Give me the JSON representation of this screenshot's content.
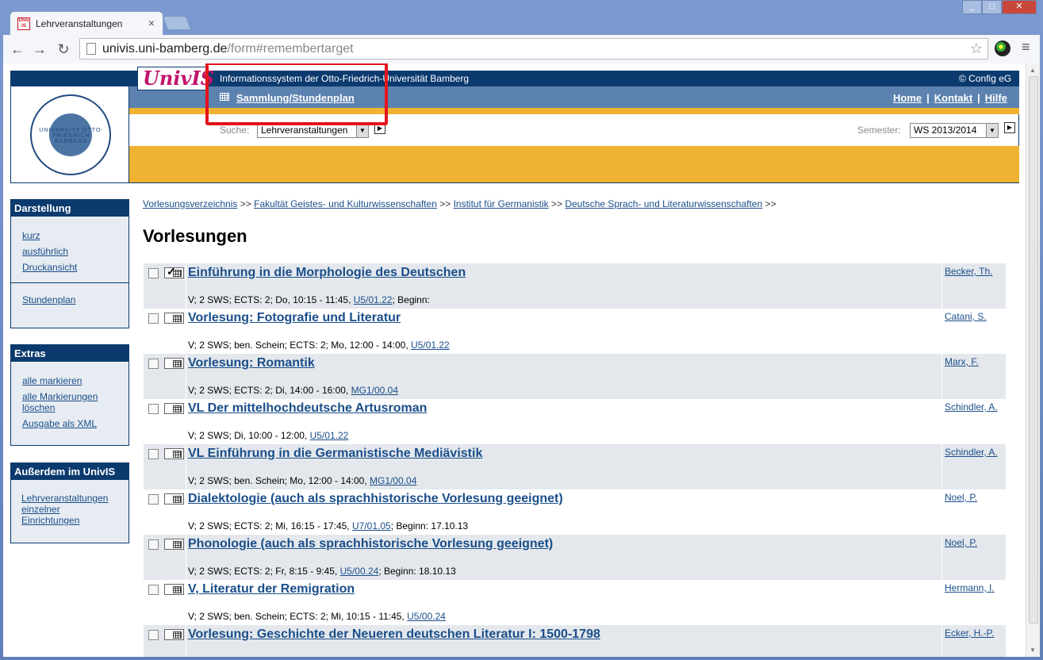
{
  "browser": {
    "tab_title": "Lehrveranstaltungen",
    "favicon_text": "Univ IS",
    "url_host": "univis.uni-bamberg.de",
    "url_rest": "/form#remembertarget"
  },
  "header": {
    "logo": "UnivIS",
    "info": "Informationssystem der Otto-Friedrich-Universität Bamberg",
    "copyright": "© Config eG",
    "sammlung": "Sammlung/Stundenplan",
    "links": [
      "Home",
      "Kontakt",
      "Hilfe"
    ],
    "search_label": "Suche:",
    "search_value": "Lehrveranstaltungen",
    "semester_label": "Semester:",
    "semester_value": "WS 2013/2014",
    "seal_text": "UNIVERSITY OTTO-FRIEDRICH BAMBERG"
  },
  "sidebar": {
    "darstellung": {
      "title": "Darstellung",
      "links": [
        "kurz",
        "ausführlich",
        "Druckansicht"
      ],
      "extra": "Stundenplan"
    },
    "extras": {
      "title": "Extras",
      "links": [
        "alle markieren",
        "alle Markierungen löschen",
        "Ausgabe als XML"
      ]
    },
    "ausserdem": {
      "title": "Außerdem im UnivIS",
      "links": [
        "Lehrveranstaltungen einzelner Einrichtungen"
      ]
    }
  },
  "breadcrumb": {
    "items": [
      "Vorlesungsverzeichnis",
      "Fakultät Geistes- und Kulturwissenschaften",
      "Institut für Germanistik",
      "Deutsche Sprach- und Literaturwissenschaften"
    ],
    "sep": ">>"
  },
  "page_title": "Vorlesungen",
  "courses": [
    {
      "title": "Einführung in die Morphologie des Deutschen",
      "details": "V; 2 SWS; ECTS: 2; Do, 10:15 - 11:45, ",
      "room": "U5/01.22",
      "suffix": "; Beginn:",
      "lecturer": "Becker, Th.",
      "checked": true
    },
    {
      "title": "Vorlesung: Fotografie und Literatur",
      "details": "V; 2 SWS; ben. Schein; ECTS: 2; Mo, 12:00 - 14:00, ",
      "room": "U5/01.22",
      "suffix": "",
      "lecturer": "Catani, S.",
      "checked": false
    },
    {
      "title": "Vorlesung: Romantik",
      "details": "V; 2 SWS; ECTS: 2; Di, 14:00 - 16:00, ",
      "room": "MG1/00.04",
      "suffix": "",
      "lecturer": "Marx, F.",
      "checked": false
    },
    {
      "title": "VL Der mittelhochdeutsche Artusroman",
      "details": "V; 2 SWS; Di, 10:00 - 12:00, ",
      "room": "U5/01.22",
      "suffix": "",
      "lecturer": "Schindler, A.",
      "checked": false
    },
    {
      "title": "VL Einführung in die Germanistische Mediävistik",
      "details": "V; 2 SWS; ben. Schein; Mo, 12:00 - 14:00, ",
      "room": "MG1/00.04",
      "suffix": "",
      "lecturer": "Schindler, A.",
      "checked": false
    },
    {
      "title": "Dialektologie (auch als sprachhistorische Vorlesung geeignet)",
      "details": "V; 2 SWS; ECTS: 2; Mi, 16:15 - 17:45, ",
      "room": "U7/01.05",
      "suffix": "; Beginn: 17.10.13",
      "lecturer": "Noel, P.",
      "checked": false
    },
    {
      "title": "Phonologie (auch als sprachhistorische Vorlesung geeignet)",
      "details": "V; 2 SWS; ECTS: 2; Fr, 8:15 - 9:45, ",
      "room": "U5/00.24",
      "suffix": "; Beginn: 18.10.13",
      "lecturer": "Noel, P.",
      "checked": false
    },
    {
      "title": "V, Literatur der Remigration",
      "details": "V; 2 SWS; ben. Schein; ECTS: 2; Mi, 10:15 - 11:45, ",
      "room": "U5/00.24",
      "suffix": "",
      "lecturer": "Hermann, I.",
      "checked": false
    },
    {
      "title": "Vorlesung: Geschichte der Neueren deutschen Literatur I: 1500-1798",
      "details": "",
      "room": "",
      "suffix": "",
      "lecturer": "Ecker, H.-P.",
      "checked": false
    }
  ]
}
